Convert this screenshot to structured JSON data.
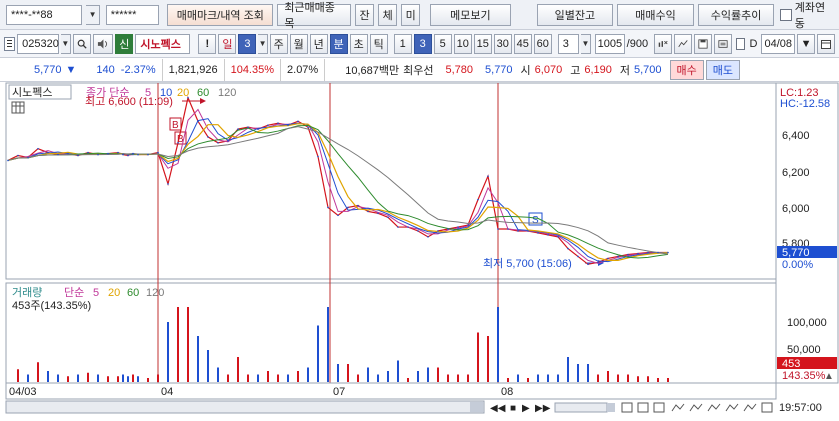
{
  "toolbar": {
    "account_no": "****-**88",
    "password": "******",
    "buttons": [
      "매매마크/내역 조회",
      "최근매매종목",
      "잔",
      "체",
      "미",
      "메모보기",
      "일별잔고",
      "매매수익",
      "수익률추이"
    ],
    "link_label": "계좌연동"
  },
  "stock_bar": {
    "code": "025320",
    "badge": "신",
    "name": "시노펙스",
    "warn": "!",
    "period_label": "일",
    "period_value": "3",
    "periods": [
      "주",
      "월",
      "년",
      "분",
      "초",
      "틱"
    ],
    "minutes": [
      "1",
      "3",
      "5",
      "10",
      "15",
      "30",
      "45",
      "60"
    ],
    "min_select": "3",
    "count": "1005",
    "count_total": "/900",
    "date": "04/08"
  },
  "quote": {
    "price": "5,770",
    "arrow": "▼",
    "change": "140",
    "change_pct": "-2.37%",
    "volume": "1,821,926",
    "vol_ratio": "104.35%",
    "turnover": "2.07%",
    "amount": "10,687백만",
    "best_label": "최우선",
    "best_ask": "5,780",
    "best_bid": "5,770",
    "open_label": "시",
    "open": "6,070",
    "high_label": "고",
    "high": "6,190",
    "low_label": "저",
    "low": "5,700",
    "buy_label": "매수",
    "sell_label": "매도"
  },
  "chart": {
    "title": "시노펙스",
    "ma_label": "종가 단순",
    "ma_periods": [
      "5",
      "10",
      "20",
      "60",
      "120"
    ],
    "ma_colors": [
      "#c0389a",
      "#1f4fd1",
      "#e0a400",
      "#2e8b2e",
      "#7a7a7a"
    ],
    "high_note": "최고 6,600 (11:09)",
    "low_note": "최저 5,700 (15:06)",
    "lc": "LC:1.23",
    "hc": "HC:-12.58",
    "price_ticks": [
      "6,400",
      "6,200",
      "6,000",
      "5,800"
    ],
    "price_current": "5,770",
    "price_pct": "0.00%",
    "volume_title": "거래량",
    "volume_ma_label": "단순",
    "volume_value": "453주(143.35%)",
    "volume_ticks": [
      "100,000",
      "50,000"
    ],
    "volume_current": "453",
    "volume_pct": "143.35%",
    "dates": [
      "04/03",
      "04",
      "07",
      "08"
    ],
    "time": "19:57:00",
    "marks": [
      "B",
      "B",
      "S"
    ]
  },
  "chart_data": {
    "type": "line",
    "title": "",
    "ylabel": "",
    "xlabel": "",
    "ylim": [
      5640,
      6620
    ],
    "series": [
      {
        "name": "종가",
        "x": [
          0,
          10,
          20,
          30,
          40,
          50,
          60,
          70,
          80,
          90,
          100,
          110,
          115,
          120,
          125,
          130,
          140,
          150,
          160,
          170,
          180,
          190,
          200,
          210,
          220,
          230,
          240,
          250,
          260,
          270,
          280,
          290,
          300,
          310,
          320,
          330,
          340,
          350,
          360,
          370,
          380,
          390,
          400,
          410,
          420,
          430,
          440,
          450,
          460,
          470,
          480,
          490,
          500,
          510,
          520,
          530,
          540,
          550,
          560,
          570,
          580,
          590,
          600,
          610,
          620,
          630,
          640,
          650,
          660
        ],
        "values": [
          6240,
          6265,
          6255,
          6300,
          6280,
          6270,
          6275,
          6265,
          6280,
          6270,
          6275,
          6280,
          6270,
          6265,
          6275,
          6270,
          6270,
          6280,
          6120,
          6330,
          6560,
          6440,
          6360,
          6330,
          6340,
          6400,
          6410,
          6400,
          6420,
          6430,
          6420,
          6440,
          6410,
          6260,
          6000,
          5960,
          6000,
          6010,
          5980,
          5970,
          5950,
          5900,
          5900,
          5880,
          5850,
          5880,
          5890,
          5900,
          5910,
          6040,
          6160,
          5890,
          5890,
          5880,
          5880,
          5870,
          5860,
          5850,
          5790,
          5750,
          5710,
          5720,
          5740,
          5750,
          5760,
          5765,
          5770,
          5770,
          5770
        ]
      }
    ]
  }
}
